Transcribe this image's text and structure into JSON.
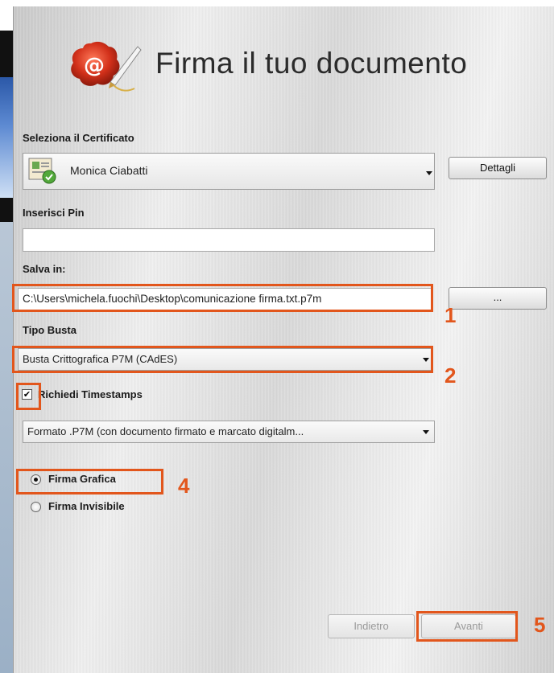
{
  "dialog": {
    "title": "Firma il tuo documento",
    "logo_icon": "wax-seal-email-quill-icon",
    "corner_glyph": "©"
  },
  "certificate": {
    "label": "Seleziona il Certificato",
    "selected": "Monica Ciabatti",
    "icon": "certificate-icon",
    "details_button": "Dettagli"
  },
  "pin": {
    "label": "Inserisci Pin",
    "value": ""
  },
  "save": {
    "label": "Salva in:",
    "path": "C:\\Users\\michela.fuochi\\Desktop\\comunicazione firma.txt.p7m",
    "browse_button": "..."
  },
  "envelope": {
    "label": "Tipo Busta",
    "selected": "Busta Crittografica P7M (CAdES)"
  },
  "timestamps": {
    "label": "Richiedi Timestamps",
    "checked": true,
    "format_selected": "Formato .P7M (con documento firmato e marcato digitalm..."
  },
  "signature_type": {
    "options": [
      {
        "label": "Firma Grafica",
        "selected": true
      },
      {
        "label": "Firma Invisibile",
        "selected": false
      }
    ]
  },
  "footer": {
    "back_button": "Indietro",
    "next_button": "Avanti"
  },
  "annotations": {
    "color": "#e2561c",
    "numbers": [
      "1",
      "2",
      "4",
      "5"
    ]
  }
}
